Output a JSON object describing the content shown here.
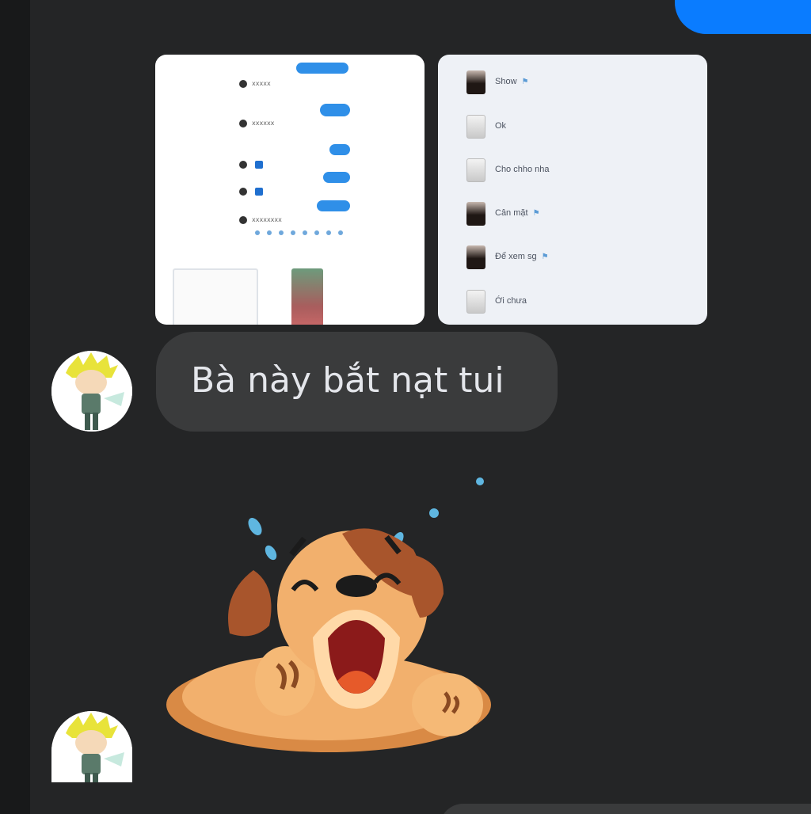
{
  "conversation": {
    "image_previews": {
      "chat_screenshot": {
        "rows": [
          "xxxxx",
          "xxxxxx",
          "xxxxxxxx"
        ]
      },
      "contact_list": {
        "contacts": [
          {
            "name": "Show",
            "pinned": true,
            "avatar": "dark"
          },
          {
            "name": "Ok",
            "pinned": false,
            "avatar": "light"
          },
          {
            "name": "Cho chho nha",
            "pinned": false,
            "avatar": "light"
          },
          {
            "name": "Cân mặt",
            "pinned": true,
            "avatar": "dark"
          },
          {
            "name": "Để xem sg",
            "pinned": true,
            "avatar": "dark"
          },
          {
            "name": "Ới chưa",
            "pinned": false,
            "avatar": "light"
          }
        ]
      }
    },
    "received_message": {
      "text": "Bà này bắt nạt tui"
    },
    "sticker": {
      "icon": "crying-dog-sticker"
    }
  },
  "colors": {
    "background": "#242526",
    "sent_bubble": "#0a7cff",
    "received_bubble": "#3a3b3c",
    "received_text": "#e4e6eb"
  }
}
